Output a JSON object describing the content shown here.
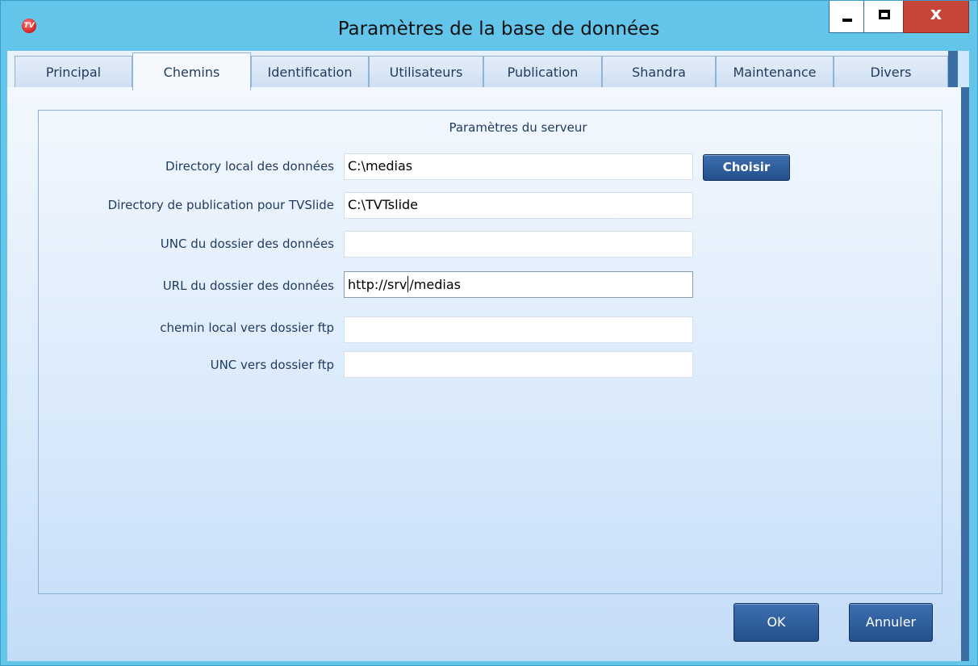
{
  "window": {
    "title": "Paramètres de la base de données",
    "app_icon_text": "TV"
  },
  "tabs": [
    {
      "label": "Principal"
    },
    {
      "label": "Chemins"
    },
    {
      "label": "Identification"
    },
    {
      "label": "Utilisateurs"
    },
    {
      "label": "Publication"
    },
    {
      "label": "Shandra"
    },
    {
      "label": "Maintenance"
    },
    {
      "label": "Divers"
    }
  ],
  "active_tab": "Chemins",
  "group": {
    "title": "Paramètres du serveur"
  },
  "fields": [
    {
      "label": "Directory local des données",
      "value": "C:\\medias"
    },
    {
      "label": "Directory de publication pour TVSlide",
      "value": "C:\\TVTslide"
    },
    {
      "label": "UNC du dossier des données",
      "value": ""
    },
    {
      "label": "URL du dossier des données",
      "value_before_caret": "http://srv",
      "value_after_caret": "/medias"
    },
    {
      "label": "chemin local vers dossier ftp",
      "value": ""
    },
    {
      "label": "UNC vers dossier ftp",
      "value": ""
    }
  ],
  "buttons": {
    "choose": "Choisir",
    "ok": "OK",
    "cancel": "Annuler"
  },
  "colors": {
    "title_bar": "#63c5ea",
    "close_button": "#c7443a",
    "button_blue": "#2a5a98"
  }
}
